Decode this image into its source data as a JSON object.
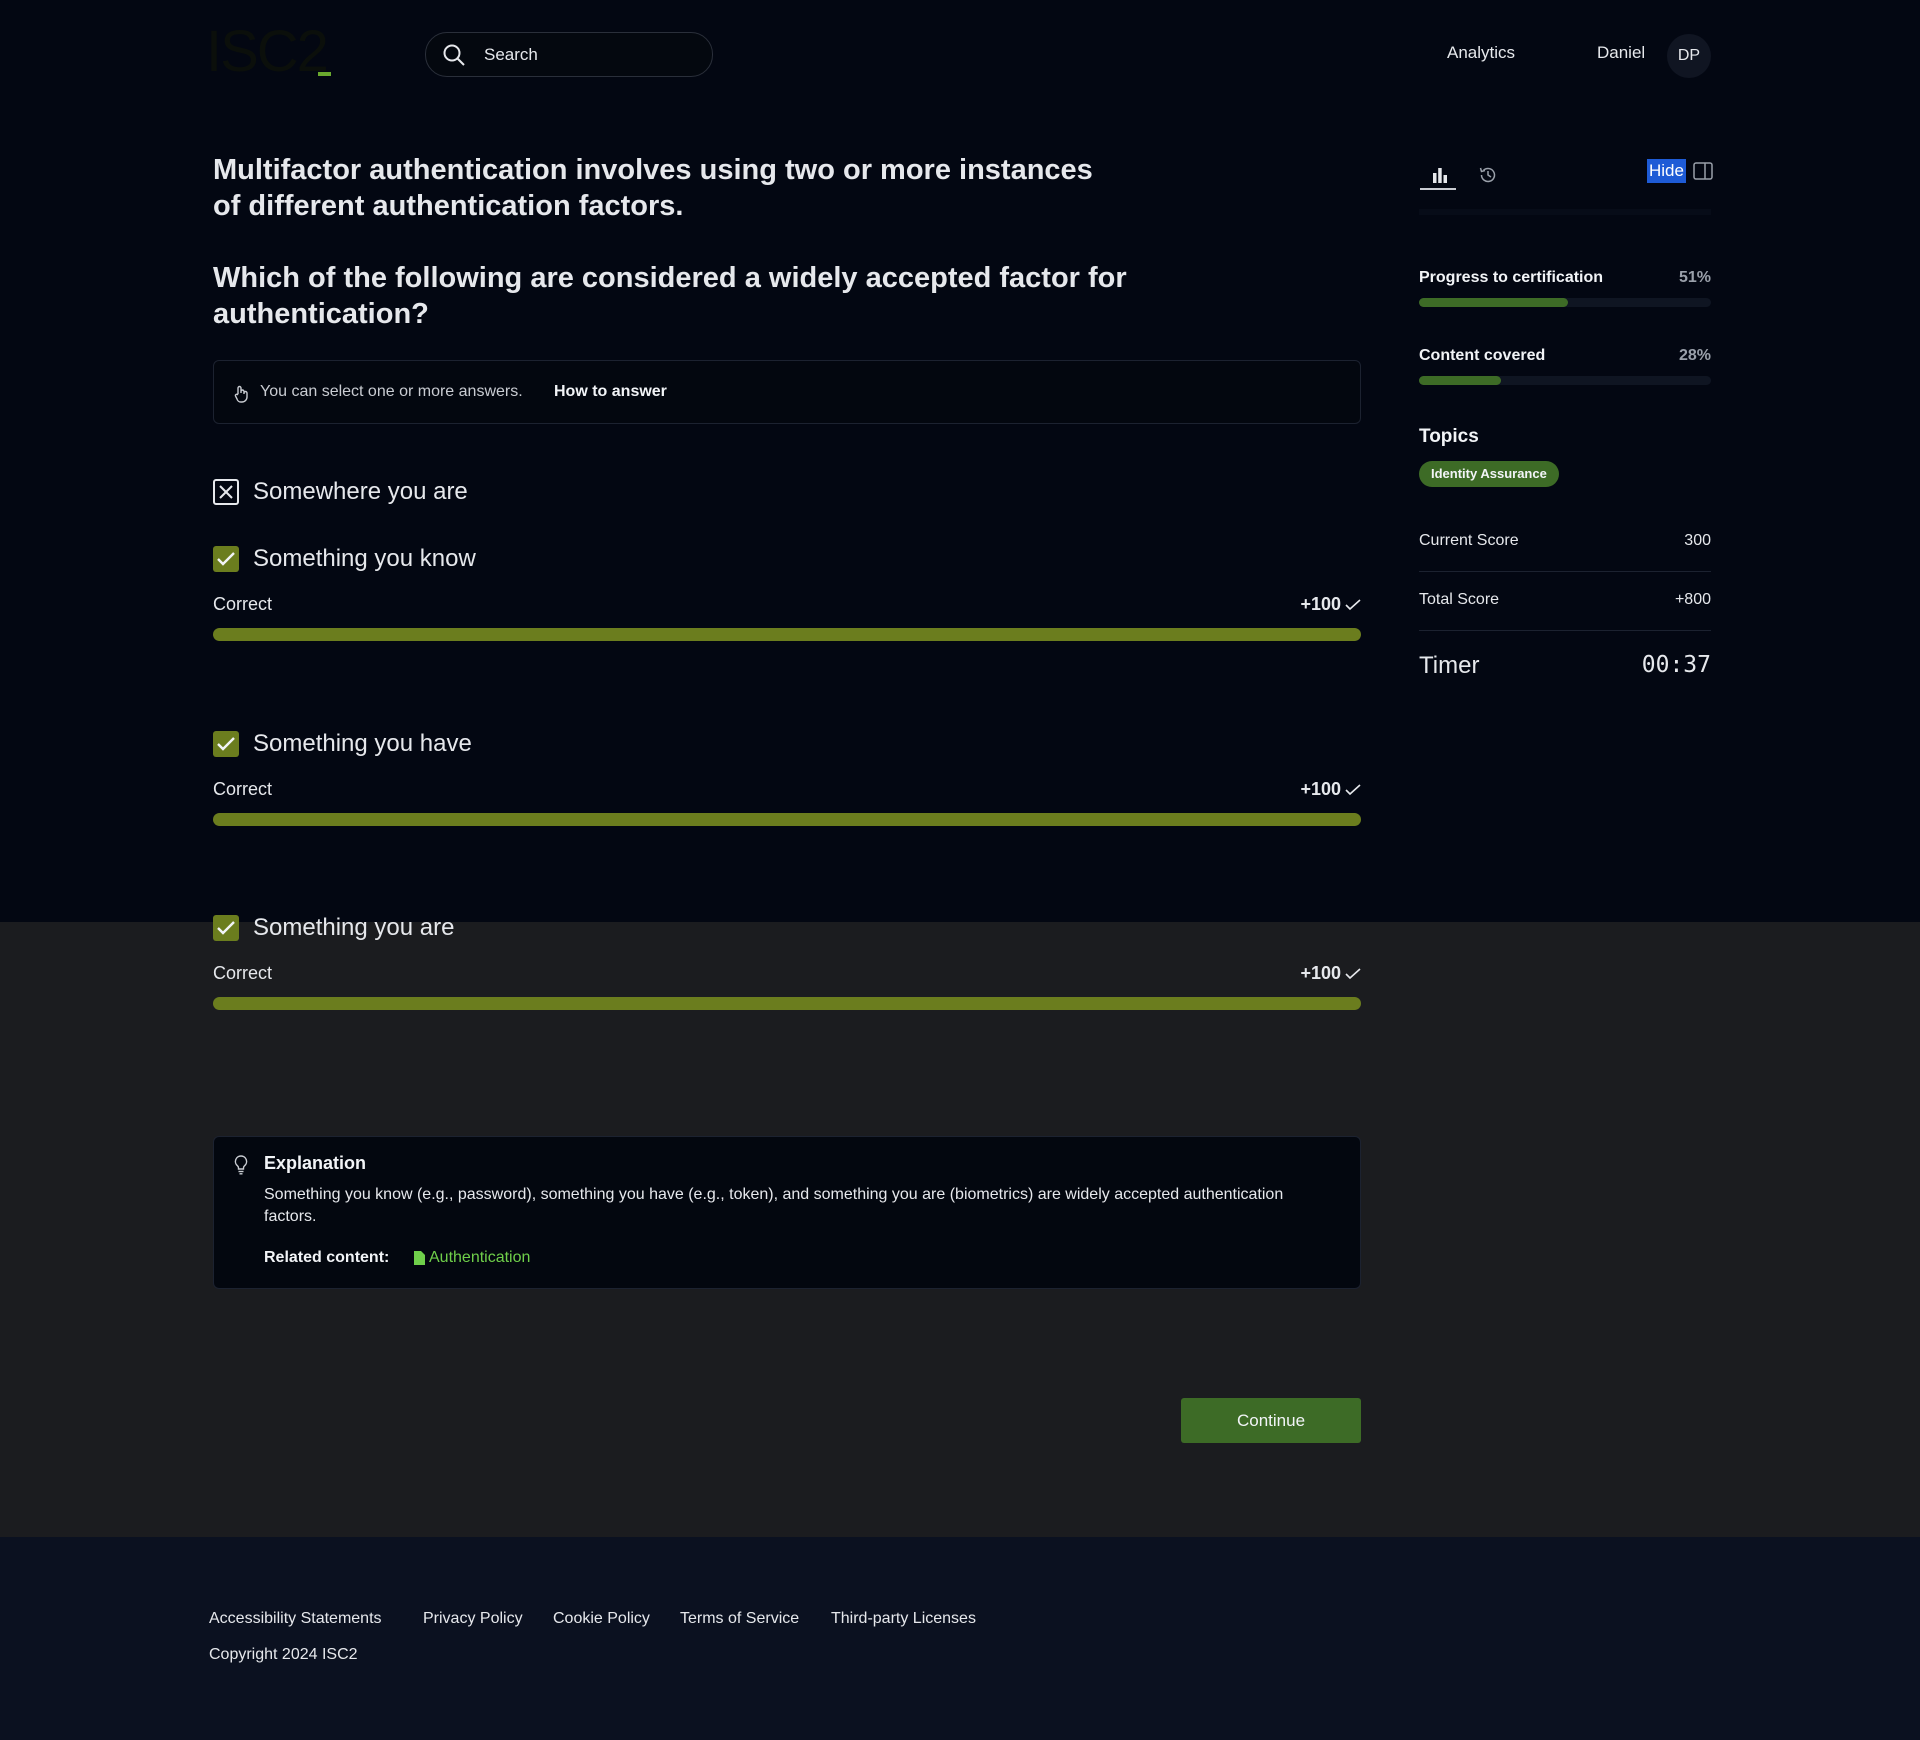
{
  "header": {
    "logo_text": "ISC2",
    "search_placeholder": "Search",
    "nav_analytics": "Analytics",
    "user_name": "Daniel",
    "user_initials": "DP"
  },
  "question": {
    "statement": "Multifactor authentication involves using two or more instances of different authentication factors.",
    "prompt": "Which of the following are considered a widely accepted factor for authentication?",
    "hint_text": "You can select one or more answers.",
    "hint_link": "How to answer"
  },
  "options": [
    {
      "label": "Somewhere you are",
      "state": "incorrect-unselected"
    },
    {
      "label": "Something you know",
      "state": "correct",
      "feedback": "Correct",
      "points": "+100"
    },
    {
      "label": "Something you have",
      "state": "correct",
      "feedback": "Correct",
      "points": "+100"
    },
    {
      "label": "Something you are",
      "state": "correct",
      "feedback": "Correct",
      "points": "+100"
    }
  ],
  "explanation": {
    "title": "Explanation",
    "text": "Something you know (e.g., password), something you have (e.g., token), and something you are (biometrics) are widely accepted authentication factors.",
    "related_label": "Related content:",
    "related_link": "Authentication"
  },
  "actions": {
    "continue_label": "Continue"
  },
  "panel": {
    "hide_label": "Hide",
    "progress_label": "Progress to certification",
    "progress_value": "51%",
    "progress_fraction": 0.51,
    "content_label": "Content covered",
    "content_value": "28%",
    "content_fraction": 0.28,
    "topics_title": "Topics",
    "topic": "Identity Assurance",
    "current_score_label": "Current Score",
    "current_score": "300",
    "total_score_label": "Total Score",
    "total_score": "+800",
    "timer_label": "Timer",
    "timer_value": "00:37"
  },
  "footer": {
    "links": [
      "Accessibility Statements",
      "Privacy Policy",
      "Cookie Policy",
      "Terms of Service",
      "Third-party Licenses"
    ],
    "copyright": "Copyright 2024 ISC2"
  },
  "colors": {
    "accent_green": "#3d6b26",
    "correct_bar": "#6b7d1e",
    "link_green": "#6fcf4a",
    "highlight_blue": "#1e5bd6"
  }
}
